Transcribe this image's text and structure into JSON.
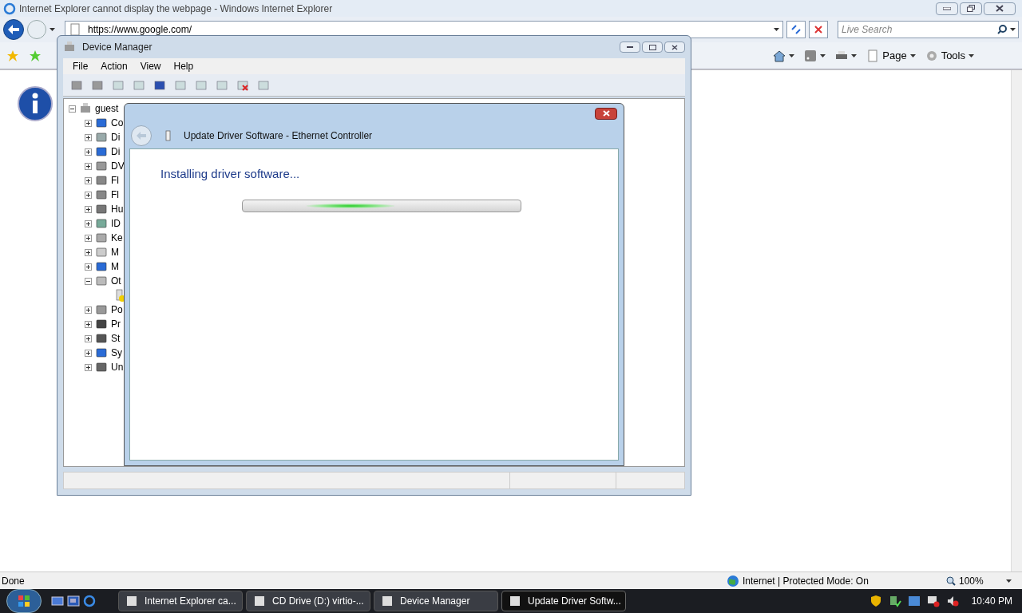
{
  "browser": {
    "title": "Internet Explorer cannot display the webpage - Windows Internet Explorer",
    "address": "https://www.google.com/",
    "search_placeholder": "Live Search",
    "toolbar": [
      {
        "kind": "home"
      },
      {
        "kind": "feeds"
      },
      {
        "kind": "print"
      },
      {
        "kind": "page",
        "label": "Page"
      },
      {
        "kind": "tools",
        "label": "Tools"
      }
    ],
    "status": "Done",
    "zone": "Internet | Protected Mode: On",
    "zoom": "100%"
  },
  "device_manager": {
    "title": "Device Manager",
    "menu": [
      "File",
      "Action",
      "View",
      "Help"
    ],
    "tree": {
      "label": "guest",
      "expanded": true,
      "children": [
        {
          "label": "Co",
          "expanded": false
        },
        {
          "label": "Di",
          "expanded": false
        },
        {
          "label": "Di",
          "expanded": false
        },
        {
          "label": "DV",
          "expanded": false
        },
        {
          "label": "Fl",
          "expanded": false
        },
        {
          "label": "Fl",
          "expanded": false
        },
        {
          "label": "Hu",
          "expanded": false
        },
        {
          "label": "ID",
          "expanded": false
        },
        {
          "label": "Ke",
          "expanded": false
        },
        {
          "label": "M",
          "expanded": false
        },
        {
          "label": "M",
          "expanded": false
        },
        {
          "label": "Ot",
          "expanded": true,
          "children": [
            {
              "warning": true
            }
          ]
        },
        {
          "label": "Po",
          "expanded": false
        },
        {
          "label": "Pr",
          "expanded": false
        },
        {
          "label": "St",
          "expanded": false
        },
        {
          "label": "Sy",
          "expanded": false
        },
        {
          "label": "Un",
          "expanded": false
        }
      ]
    }
  },
  "dialog": {
    "title": "Update Driver Software - Ethernet Controller",
    "heading": "Installing driver software..."
  },
  "taskbar": {
    "tasks": [
      {
        "label": "Internet Explorer ca...",
        "selected": false
      },
      {
        "label": "CD Drive (D:) virtio-...",
        "selected": false
      },
      {
        "label": "Device Manager",
        "selected": false
      },
      {
        "label": "Update Driver Softw...",
        "selected": true
      }
    ],
    "clock": "10:40 PM"
  }
}
